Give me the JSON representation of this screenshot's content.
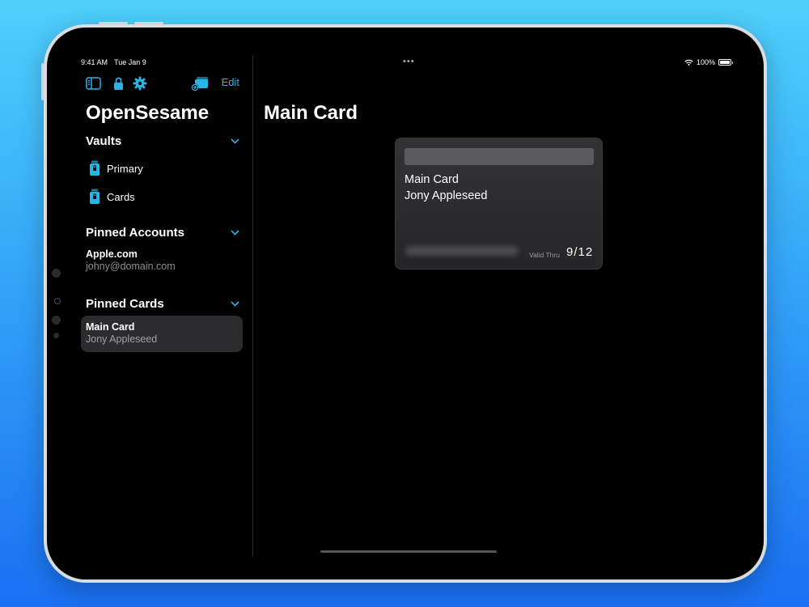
{
  "status": {
    "time": "9:41 AM",
    "date": "Tue Jan 9",
    "dots": "•••",
    "battery": "100%"
  },
  "toolbar": {
    "edit_label": "Edit",
    "icons": [
      "sidebar-icon",
      "lock-icon",
      "gear-icon",
      "add-card-icon"
    ]
  },
  "app": {
    "title": "OpenSesame"
  },
  "sidebar": {
    "vaults": {
      "title": "Vaults",
      "items": [
        {
          "label": "Primary",
          "icon": "vault-icon"
        },
        {
          "label": "Cards",
          "icon": "vault-icon"
        }
      ]
    },
    "pinned_accounts": {
      "title": "Pinned Accounts",
      "items": [
        {
          "name": "Apple.com",
          "username": "johny@domain.com"
        }
      ]
    },
    "pinned_cards": {
      "title": "Pinned Cards",
      "items": [
        {
          "name": "Main Card",
          "holder": "Jony Appleseed",
          "selected": true
        }
      ]
    }
  },
  "main": {
    "title": "Main Card",
    "card": {
      "name": "Main Card",
      "holder": "Jony Appleseed",
      "valid_label": "Valid Thru",
      "valid_value": "9/12"
    }
  },
  "colors": {
    "accent": "#27b5e6",
    "background": "#000000",
    "selected_row": "#2c2c2e"
  }
}
